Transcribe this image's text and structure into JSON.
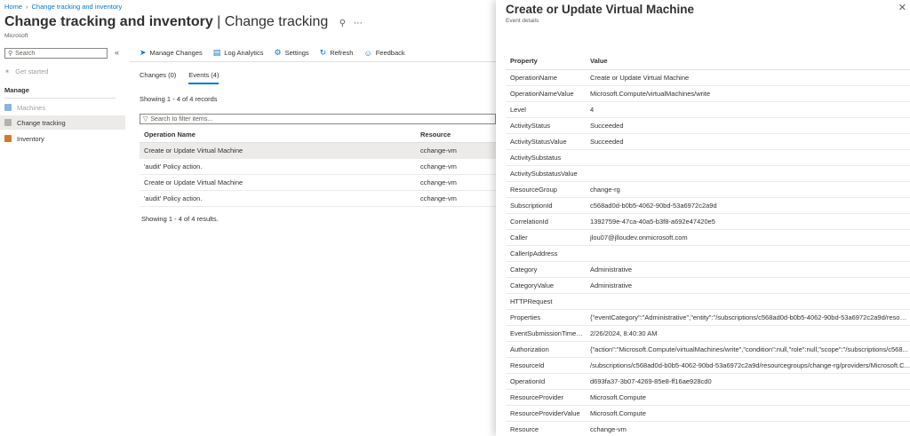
{
  "breadcrumb": [
    "Home",
    "Change tracking and inventory"
  ],
  "title": {
    "bold": "Change tracking and inventory",
    "light": " | Change tracking"
  },
  "subtitle": "Microsoft",
  "sidebar": {
    "search_placeholder": "Search",
    "get_started": "Get started",
    "section": "Manage",
    "items": [
      "Machines",
      "Change tracking",
      "Inventory"
    ]
  },
  "toolbar": {
    "manage_changes": "Manage Changes",
    "log_analytics": "Log Analytics",
    "settings": "Settings",
    "refresh": "Refresh",
    "feedback": "Feedback"
  },
  "tabs": {
    "changes": "Changes (0)",
    "events": "Events (4)"
  },
  "records_text": "Showing 1 - 4 of 4 records",
  "filter_placeholder": "Search to filter items...",
  "events_table": {
    "headers": [
      "Operation Name",
      "Resource"
    ],
    "rows": [
      [
        "Create or Update Virtual Machine",
        "cchange-vm"
      ],
      [
        "'audit' Policy action.",
        "cchange-vm"
      ],
      [
        "Create or Update Virtual Machine",
        "cchange-vm"
      ],
      [
        "'audit' Policy action.",
        "cchange-vm"
      ]
    ]
  },
  "results_text": "Showing 1 - 4 of 4 results.",
  "panel": {
    "title": "Create or Update Virtual Machine",
    "subtitle": "Event details",
    "headers": [
      "Property",
      "Value"
    ],
    "rows": [
      [
        "OperationName",
        "Create or Update Virtual Machine"
      ],
      [
        "OperationNameValue",
        "Microsoft.Compute/virtualMachines/write"
      ],
      [
        "Level",
        "4"
      ],
      [
        "ActivityStatus",
        "Succeeded"
      ],
      [
        "ActivityStatusValue",
        "Succeeded"
      ],
      [
        "ActivitySubstatus",
        ""
      ],
      [
        "ActivitySubstatusValue",
        ""
      ],
      [
        "ResourceGroup",
        "change-rg"
      ],
      [
        "SubscriptionId",
        "c568ad0d-b0b5-4062-90bd-53a6972c2a9d"
      ],
      [
        "CorrelationId",
        "1392759e-47ca-40a5-b3f8-a692e47420e5"
      ],
      [
        "Caller",
        "jlou07@jlloudev.onmicrosoft.com"
      ],
      [
        "CallerIpAddress",
        ""
      ],
      [
        "Category",
        "Administrative"
      ],
      [
        "CategoryValue",
        "Administrative"
      ],
      [
        "HTTPRequest",
        ""
      ],
      [
        "Properties",
        "{\"eventCategory\":\"Administrative\",\"entity\":\"/subscriptions/c568ad0d-b0b5-4062-90bd-53a6972c2a9d/resour..."
      ],
      [
        "EventSubmissionTimest...",
        "2/26/2024, 8:40:30 AM"
      ],
      [
        "Authorization",
        "{\"action\":\"Microsoft.Compute/virtualMachines/write\",\"condition\":null,\"role\":null,\"scope\":\"/subscriptions/c568..."
      ],
      [
        "ResourceId",
        "/subscriptions/c568ad0d-b0b5-4062-90bd-53a6972c2a9d/resourcegroups/change-rg/providers/Microsoft.C..."
      ],
      [
        "OperationId",
        "d693fa37-3b07-4269-85e8-ff16ae928cd0"
      ],
      [
        "ResourceProvider",
        "Microsoft.Compute"
      ],
      [
        "ResourceProviderValue",
        "Microsoft.Compute"
      ],
      [
        "Resource",
        "cchange-vm"
      ]
    ]
  },
  "colors": {
    "accent": "#0078d4",
    "selected_row": "#edebe9"
  }
}
